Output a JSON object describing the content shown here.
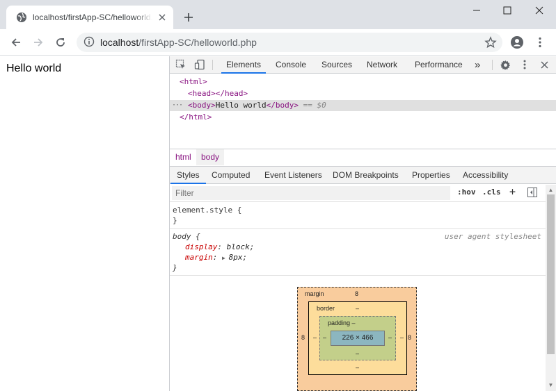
{
  "browser": {
    "tab_title": "localhost/firstApp-SC/helloworld.php",
    "url_host": "localhost",
    "url_path": "/firstApp-SC/helloworld.php"
  },
  "page": {
    "content_text": "Hello world"
  },
  "devtools": {
    "main_tabs": [
      "Elements",
      "Console",
      "Sources",
      "Network",
      "Performance"
    ],
    "more_label": "»",
    "dom": {
      "html_open": "<html>",
      "head": "<head></head>",
      "body_open": "<body>",
      "body_text": "Hello world",
      "body_close": "</body>",
      "selected_suffix": "== $0",
      "html_close": "</html>",
      "dots": "···"
    },
    "breadcrumbs": [
      "html",
      "body"
    ],
    "sub_tabs": [
      "Styles",
      "Computed",
      "Event Listeners",
      "DOM Breakpoints",
      "Properties",
      "Accessibility"
    ],
    "filter_placeholder": "Filter",
    "hov_label": ":hov",
    "cls_label": ".cls",
    "plus_label": "+",
    "element_style": {
      "selector": "element.style {",
      "close": "}"
    },
    "body_rule": {
      "selector": "body",
      "open": " {",
      "origin": "user agent stylesheet",
      "props": [
        {
          "name": "display",
          "value": "block"
        },
        {
          "name": "margin",
          "value": "8px"
        }
      ],
      "close": "}"
    },
    "box_model": {
      "margin_label": "margin",
      "margin_top": "8",
      "margin_left": "8",
      "margin_right": "8",
      "border_label": "border",
      "border_top": "–",
      "border_left": "–",
      "border_right": "–",
      "border_bottom": "–",
      "padding_label": "padding –",
      "padding_left": "–",
      "padding_right": "–",
      "padding_bottom": "–",
      "content_size": "226 × 466"
    }
  }
}
